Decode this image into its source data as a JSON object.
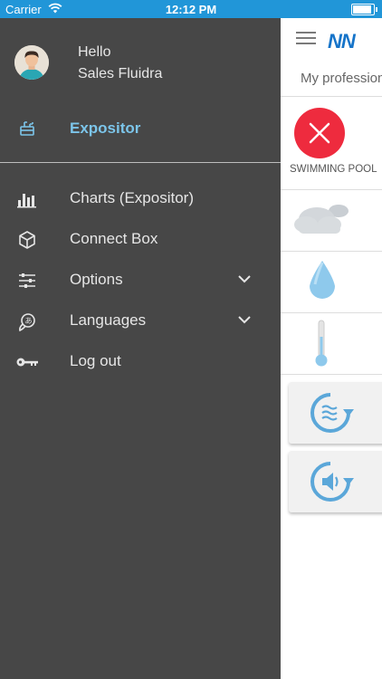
{
  "status_bar": {
    "carrier": "Carrier",
    "time": "12:12 PM",
    "battery_level": 0.9
  },
  "drawer": {
    "greeting": "Hello",
    "user_name": "Sales Fluidra",
    "current_item": {
      "label": "Expositor",
      "icon": "expositor-icon"
    },
    "items": [
      {
        "label": "Charts (Expositor)",
        "icon": "bar-chart-icon",
        "expandable": false
      },
      {
        "label": "Connect Box",
        "icon": "cube-icon",
        "expandable": false
      },
      {
        "label": "Options",
        "icon": "sliders-icon",
        "expandable": true
      },
      {
        "label": "Languages",
        "icon": "language-icon",
        "expandable": true
      },
      {
        "label": "Log out",
        "icon": "key-icon",
        "expandable": false
      }
    ]
  },
  "content": {
    "logo": "NN",
    "subtitle": "My professional",
    "pool_label": "SWIMMING POOL",
    "accent_color": "#7cc5ea",
    "status_color": "#ee2b3e",
    "brand_color": "#1674c9"
  }
}
